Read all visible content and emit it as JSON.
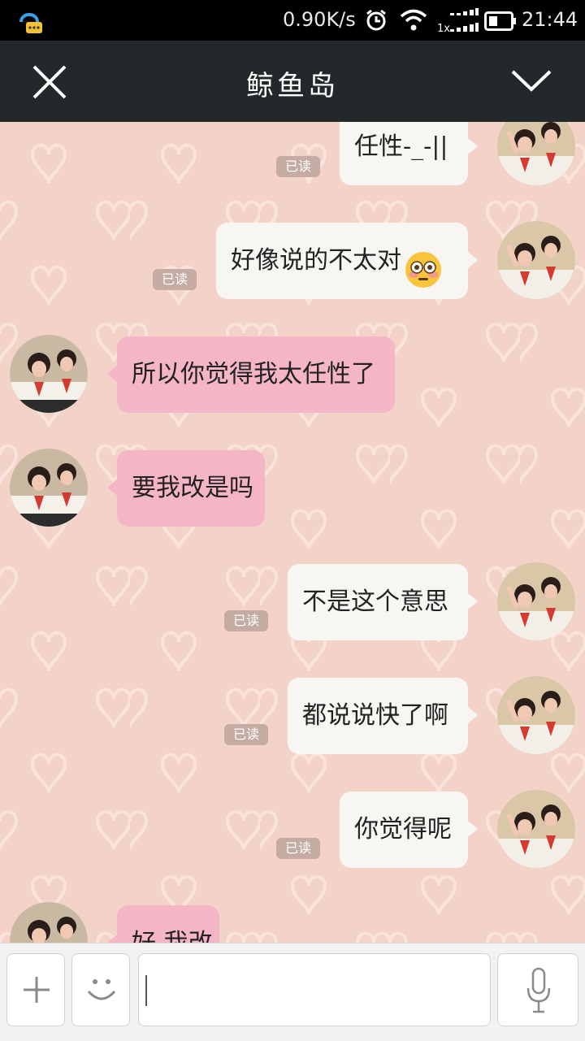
{
  "status_bar": {
    "speed": "0.90K/s",
    "time": "21:44",
    "sim_label": "1x"
  },
  "header": {
    "title": "鲸鱼岛"
  },
  "messages": [
    {
      "text": "任性-_-||",
      "read": "已读"
    },
    {
      "text": "好像说的不太对",
      "emoji": "flushed-face",
      "read": "已读"
    },
    {
      "text": "所以你觉得我太任性了"
    },
    {
      "text": "要我改是吗"
    },
    {
      "text": "不是这个意思",
      "read": "已读"
    },
    {
      "text": "都说说快了啊",
      "read": "已读"
    },
    {
      "text": "你觉得呢",
      "read": "已读"
    },
    {
      "text": "好 我改"
    }
  ],
  "input": {
    "value": ""
  },
  "icons": {
    "app": "chat-app-icon",
    "alarm": "alarm-icon",
    "wifi": "wifi-icon",
    "signal": "signal-icon",
    "battery": "battery-icon",
    "close": "close-icon",
    "chevron": "chevron-down-icon",
    "plus": "plus-icon",
    "smile": "smile-icon",
    "mic": "microphone-icon"
  },
  "colors": {
    "header_bg": "#23292a",
    "chat_bg": "#f3d3c8",
    "my_bubble": "#f8f6f2",
    "their_bubble": "#f4b5c6",
    "read_badge": "#c4aba3"
  }
}
